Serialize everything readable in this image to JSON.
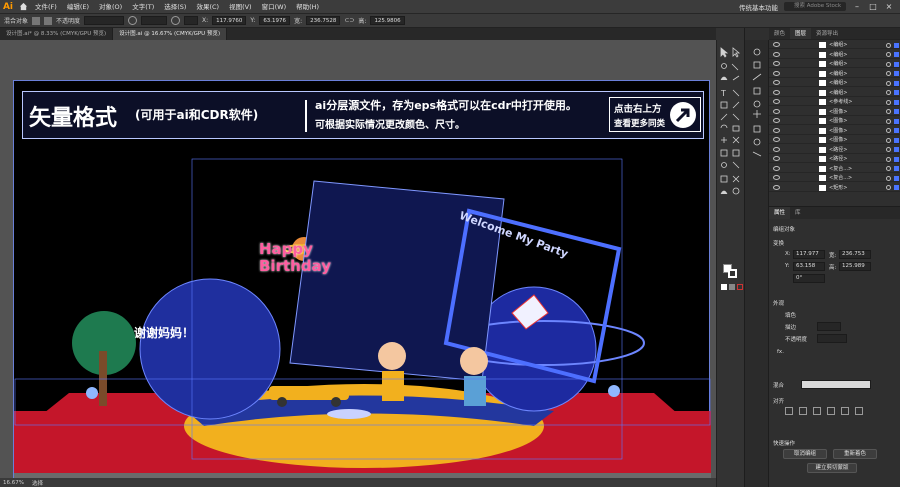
{
  "app": {
    "logo": "Ai",
    "workspace": "传统基本功能",
    "stock_search": "搜索 Adobe Stock"
  },
  "menu": [
    "文件(F)",
    "编辑(E)",
    "对象(O)",
    "文字(T)",
    "选择(S)",
    "效果(C)",
    "视图(V)",
    "窗口(W)",
    "帮助(H)"
  ],
  "control": {
    "selection_label": "编组",
    "mode_label": "混合对象",
    "opacity_label": "不透明度",
    "x": "117.9760",
    "y": "63.1976",
    "w": "236.7528",
    "h": "125.9806"
  },
  "tabs": [
    {
      "label": "设计图.ai* @ 8.33% (CMYK/GPU 预览)",
      "active": false
    },
    {
      "label": "设计图.ai @ 16.67% (CMYK/GPU 预览)",
      "active": true
    }
  ],
  "artwork": {
    "banner_big": "矢量格式",
    "banner_paren": "(可用于ai和CDR软件)",
    "banner_line1": "ai分层源文件，存为eps格式可以在cdr中打开使用。",
    "banner_line2": "可根据实际情况更改颜色、尺寸。",
    "cta_1": "点击右上方",
    "cta_2": "查看更多同类",
    "happy_1": "Happy",
    "happy_2": "Birthday",
    "welcome": "Welcome My Party",
    "thanks": "谢谢妈妈！"
  },
  "status": {
    "zoom": "16.67%",
    "tool": "选择"
  },
  "layers": {
    "tabs": [
      "颜色",
      "图层",
      "资源导出"
    ],
    "rows": [
      "<编组>",
      "<编组>",
      "<编组>",
      "<编组>",
      "<编组>",
      "<编组>",
      "<参考线>",
      "<图像>",
      "<图像>",
      "<图像>",
      "<图像>",
      "<路径>",
      "<路径>",
      "<复合...>",
      "<复合...>",
      "<矩形>"
    ]
  },
  "properties": {
    "tabs": [
      "属性",
      "库"
    ],
    "group_label": "编组对象",
    "transform_label": "变换",
    "x": "117.977",
    "y": "63.158",
    "w": "236.753",
    "h": "125.989",
    "angle": "0°",
    "appearance_label": "外观",
    "stroke_label": "描边",
    "fill_label": "填色",
    "opacity_label": "不透明度",
    "fx": "fx.",
    "blend_label": "混合",
    "align_label": "对齐",
    "quick_actions_label": "快速操作",
    "btn_ungroup": "取消编组",
    "btn_recolor": "重新着色",
    "btn_clip": "建立剪切蒙版"
  },
  "colors": {
    "accent": "#ff9a00",
    "select": "#4a74ff",
    "stage_red": "#c4162a",
    "stage_yellow": "#f2b01e",
    "navy": "#0c0f27"
  }
}
